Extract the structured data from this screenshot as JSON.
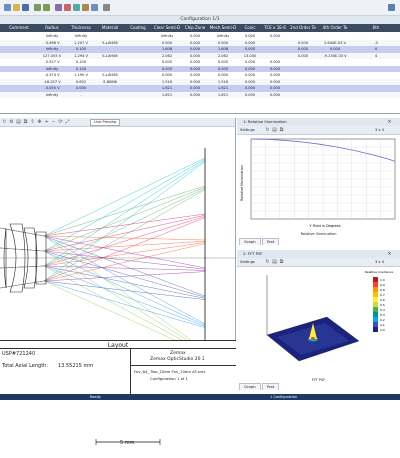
{
  "app": {
    "name": "Zemax OpticStudio 20.1",
    "company": "Zemax"
  },
  "lens_editor": {
    "title": "Configuration 1/1",
    "columns": [
      "Comment",
      "Radius",
      "Thickness",
      "Material",
      "Coating",
      "Clear Semi-D",
      "Chip Zone",
      "Mech Semi-D",
      "Conic",
      "TCE x 1E-6",
      "2nd Order Te",
      "4th Order Te",
      "6th"
    ],
    "rows": [
      [
        "",
        "Infinity",
        "Infinity",
        "",
        "",
        "Infinity",
        "0.000",
        "Infinity",
        "0.000",
        "0.000",
        "",
        "",
        ""
      ],
      [
        "",
        "-3.566  V",
        "1.207  V",
        "S-LAH58",
        "",
        "0.000",
        "0.000",
        "0.000",
        "0.000",
        "",
        "0.000",
        "2.644E-03  V",
        "-3"
      ],
      [
        "",
        "Infinity",
        "0.100",
        "",
        "",
        "1.606",
        "0.000",
        "1.606",
        "0.000",
        "",
        "0.000",
        "0.000",
        "0"
      ],
      [
        "",
        "127.055  V",
        "1.294  V",
        "S-LAH58",
        "",
        "2.062",
        "0.000",
        "2.062",
        "13.000",
        "",
        "0.000",
        "-9.135E-03  V",
        "4"
      ],
      [
        "",
        "-5.927  V",
        "0.100",
        "",
        "",
        "0.000",
        "0.000",
        "0.000",
        "0.000",
        "0.000",
        "",
        "",
        ""
      ],
      [
        "",
        "Infinity",
        "0.100",
        "",
        "",
        "0.000",
        "0.000",
        "0.000",
        "0.000",
        "0.000",
        "",
        "",
        ""
      ],
      [
        "",
        "-4.374  V",
        "1.190  V",
        "S-LAH58",
        "",
        "0.000",
        "0.000",
        "0.000",
        "0.000",
        "0.000",
        "",
        "",
        ""
      ],
      [
        "",
        "-16.257  V",
        "0.652",
        "S-NBH8",
        "",
        "1.516",
        "0.000",
        "1.516",
        "0.000",
        "0.000",
        "",
        "",
        ""
      ],
      [
        "",
        "-3.055  V",
        "0.000",
        "",
        "",
        "1.621",
        "0.000",
        "1.621",
        "0.000",
        "0.000",
        "",
        "",
        ""
      ],
      [
        "",
        "Infinity",
        "-",
        "",
        "",
        "1.621",
        "0.000",
        "1.621",
        "0.000",
        "0.000",
        "",
        "",
        ""
      ]
    ]
  },
  "layout_panel": {
    "toolbar_label": "Settings",
    "view_label": "Live Preview",
    "scale_label": "5 mm",
    "caption": "Layout",
    "title_block": {
      "patent": "USP#721240",
      "length_label": "Total Axial Length:",
      "length_value": "13.55215 mm",
      "company": "Zemax",
      "product": "Zemax OpticStudio 20.1",
      "file": "Fov_84_ Two_1Sem Fov_10em AT.zmx",
      "config": "Configuration 1 of 1"
    }
  },
  "relative_illumination": {
    "title": "1: Relative Illumination",
    "settings_label": "Settings",
    "ylabel": "Relative Illumination",
    "xlabel": "Y Field in Degrees",
    "footer": "Relative Illumination",
    "tabs": [
      "Graph",
      "Text"
    ],
    "zoom": "3 x 4"
  },
  "psf": {
    "title": "2: FFT PSF",
    "settings_label": "Settings",
    "footer": "FFT PSF",
    "tabs": [
      "Graph",
      "Text"
    ],
    "zoom": "3 x 4",
    "legend_title": "Relative Irradiance",
    "legend_values": [
      "1.0",
      "0.9",
      "0.8",
      "0.7",
      "0.6",
      "0.5",
      "0.4",
      "0.3",
      "0.2",
      "0.1",
      "0.0"
    ]
  },
  "chart_data": [
    {
      "type": "line",
      "x": [
        0,
        5,
        10,
        15,
        20,
        25,
        30,
        35,
        40,
        42
      ],
      "series": [
        {
          "values": [
            1.0,
            0.995,
            0.982,
            0.962,
            0.935,
            0.9,
            0.858,
            0.808,
            0.75,
            0.72
          ]
        }
      ],
      "ylim": [
        0,
        1.0
      ],
      "xlim": [
        0,
        42
      ],
      "grid": true
    }
  ],
  "status": {
    "left": "Ready",
    "mid": "1 Configuration"
  },
  "colors": {
    "header": "#3c4c60",
    "highlight": "#c6ccf2",
    "accent": "#1d3a66"
  }
}
